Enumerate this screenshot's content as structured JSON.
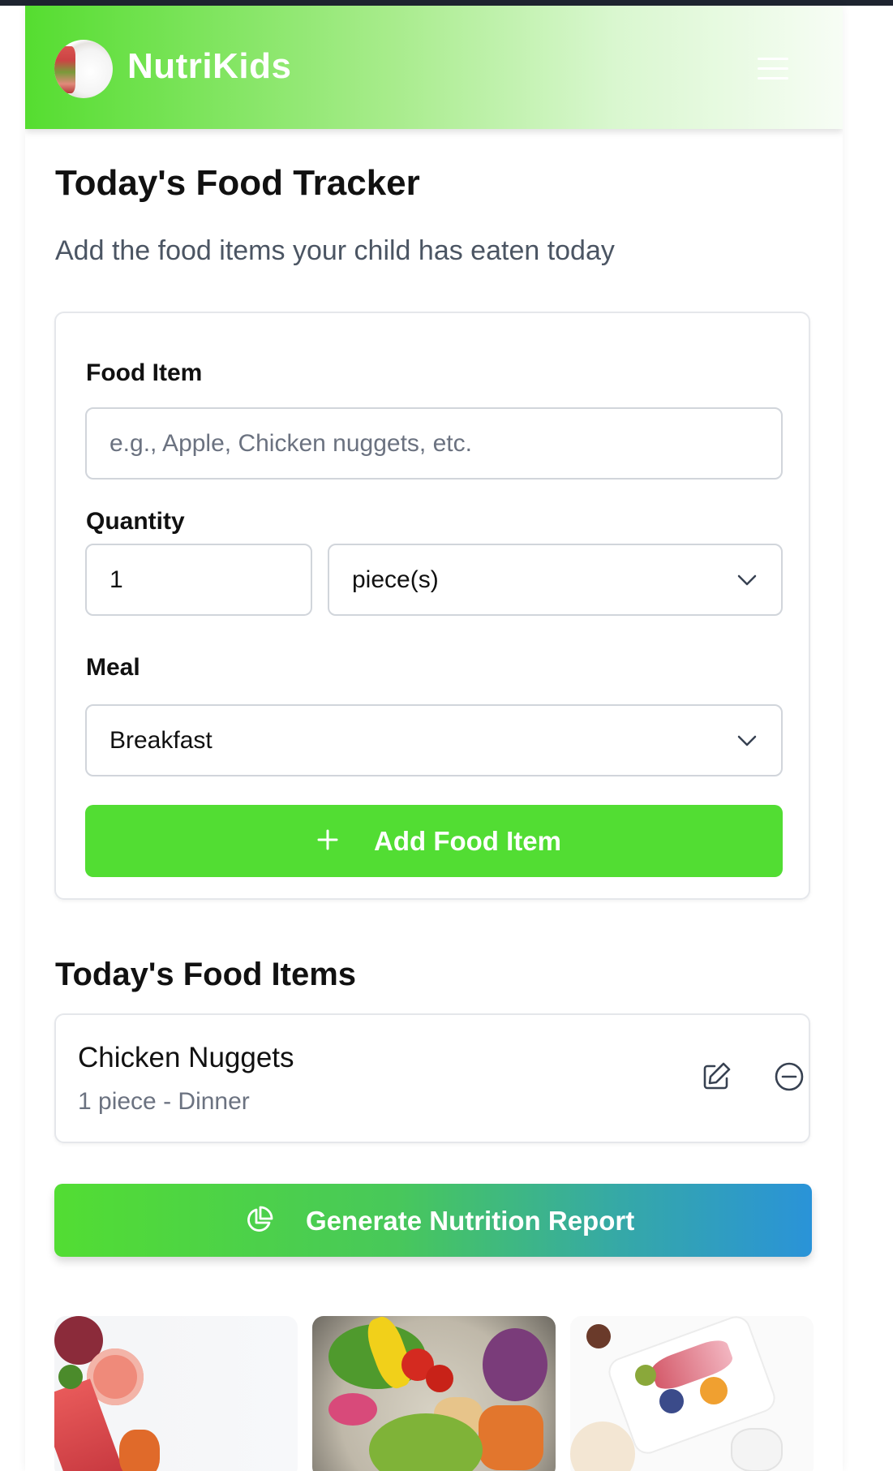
{
  "app": {
    "brand": "NutriKids"
  },
  "page": {
    "title": "Today's Food Tracker",
    "subtitle": "Add the food items your child has eaten today"
  },
  "form": {
    "food_label": "Food Item",
    "food_placeholder": "e.g., Apple, Chicken nuggets, etc.",
    "food_value": "",
    "quantity_label": "Quantity",
    "quantity_value": "1",
    "unit_selected": "piece(s)",
    "meal_label": "Meal",
    "meal_selected": "Breakfast",
    "add_button": "Add Food Item"
  },
  "items_section": {
    "title": "Today's Food Items",
    "items": [
      {
        "name": "Chicken Nuggets",
        "detail": "1 piece - Dinner"
      }
    ]
  },
  "report_button": "Generate Nutrition Report",
  "icons": {
    "menu": "hamburger-menu-icon",
    "add": "plus-icon",
    "edit": "edit-icon",
    "remove": "minus-circle-icon",
    "report": "pie-chart-icon"
  },
  "colors": {
    "brand_green": "#52dd33",
    "report_gradient_end": "#2a93d8",
    "muted_text": "#6b7280"
  }
}
